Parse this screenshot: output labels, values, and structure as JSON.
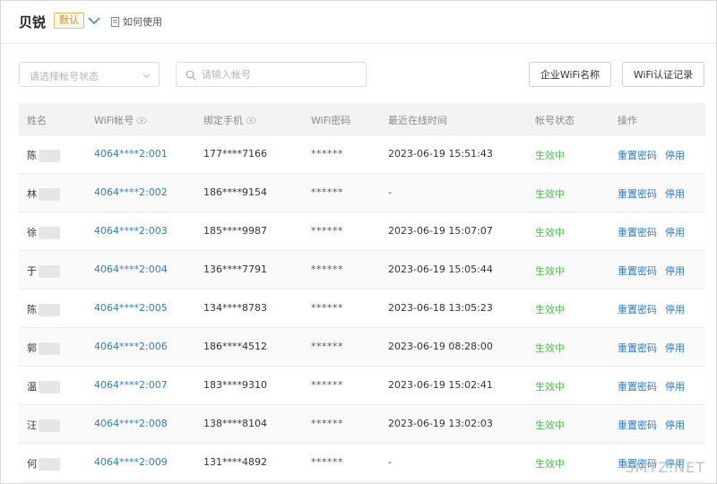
{
  "header": {
    "brand": "贝锐",
    "badge": "默认",
    "help_label": "如何使用"
  },
  "toolbar": {
    "status_select_placeholder": "请选择帐号状态",
    "search_placeholder": "请输入帐号",
    "btn_enterprise_wifi": "企业WiFi名称",
    "btn_wifi_log": "WiFi认证记录"
  },
  "table": {
    "columns": {
      "name": "姓名",
      "wifi_account": "WiFi帐号",
      "phone": "绑定手机",
      "wifi_password": "WiFi密码",
      "last_online": "最近在线时间",
      "status": "帐号状态",
      "actions": "操作"
    },
    "rows": [
      {
        "name": "陈",
        "wifi": "4064****2:001",
        "phone": "177****7166",
        "pwd": "******",
        "time": "2023-06-19 15:51:43",
        "status": "生效中",
        "reset": "重置密码",
        "disable": "停用"
      },
      {
        "name": "林",
        "wifi": "4064****2:002",
        "phone": "186****9154",
        "pwd": "******",
        "time": "-",
        "status": "生效中",
        "reset": "重置密码",
        "disable": "停用"
      },
      {
        "name": "徐",
        "wifi": "4064****2:003",
        "phone": "185****9987",
        "pwd": "******",
        "time": "2023-06-19 15:07:07",
        "status": "生效中",
        "reset": "重置密码",
        "disable": "停用"
      },
      {
        "name": "于",
        "wifi": "4064****2:004",
        "phone": "136****7791",
        "pwd": "******",
        "time": "2023-06-19 15:05:44",
        "status": "生效中",
        "reset": "重置密码",
        "disable": "停用"
      },
      {
        "name": "陈",
        "wifi": "4064****2:005",
        "phone": "134****8783",
        "pwd": "******",
        "time": "2023-06-18 13:05:23",
        "status": "生效中",
        "reset": "重置密码",
        "disable": "停用"
      },
      {
        "name": "郭",
        "wifi": "4064****2:006",
        "phone": "186****4512",
        "pwd": "******",
        "time": "2023-06-19 08:28:00",
        "status": "生效中",
        "reset": "重置密码",
        "disable": "停用"
      },
      {
        "name": "温",
        "wifi": "4064****2:007",
        "phone": "183****9310",
        "pwd": "******",
        "time": "2023-06-19 15:02:41",
        "status": "生效中",
        "reset": "重置密码",
        "disable": "停用"
      },
      {
        "name": "汪",
        "wifi": "4064****2:008",
        "phone": "138****8104",
        "pwd": "******",
        "time": "2023-06-19 13:02:03",
        "status": "生效中",
        "reset": "重置密码",
        "disable": "停用"
      },
      {
        "name": "何",
        "wifi": "4064****2:009",
        "phone": "131****4892",
        "pwd": "******",
        "time": "-",
        "status": "生效中",
        "reset": "重置密码",
        "disable": "停用"
      }
    ]
  },
  "watermark": "SMYZ.NET",
  "colors": {
    "link": "#2f7cc8",
    "status_active": "#4cbf4c",
    "badge": "#e08a1e"
  },
  "icons": {
    "dropdown": "chevron-down-icon",
    "help": "document-icon",
    "search": "search-icon",
    "visibility": "eye-icon"
  }
}
